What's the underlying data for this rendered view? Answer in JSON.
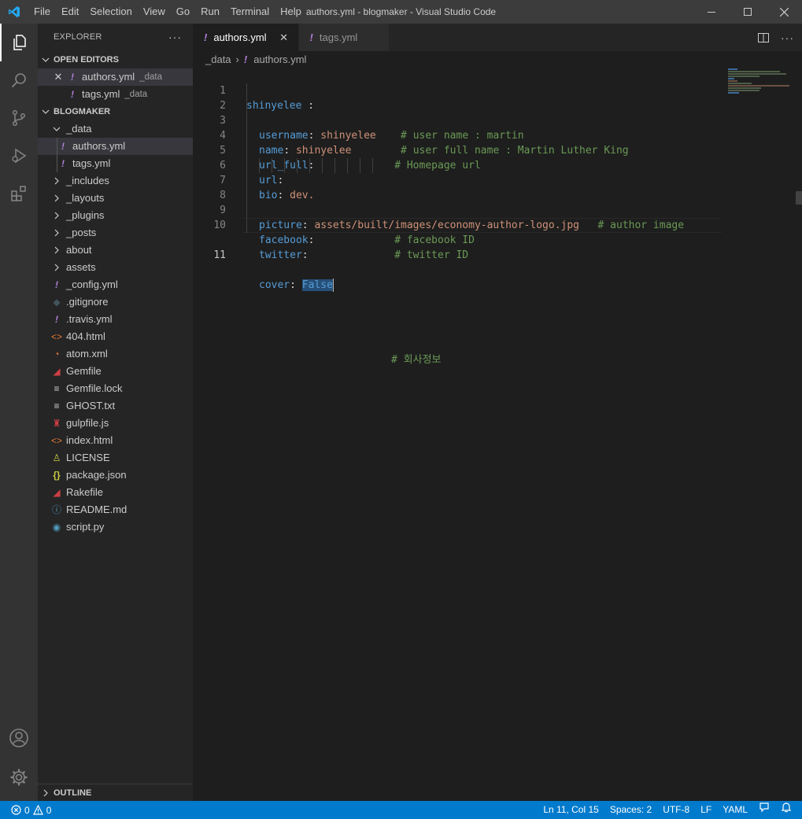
{
  "window": {
    "title": "authors.yml - blogmaker - Visual Studio Code"
  },
  "menu": [
    "File",
    "Edit",
    "Selection",
    "View",
    "Go",
    "Run",
    "Terminal",
    "Help"
  ],
  "sidebar": {
    "title": "EXPLORER",
    "open_editors": {
      "header": "OPEN EDITORS",
      "items": [
        {
          "name": "authors.yml",
          "desc": "_data"
        },
        {
          "name": "tags.yml",
          "desc": "_data"
        }
      ]
    },
    "project": {
      "header": "BLOGMAKER",
      "data_folder": "_data",
      "data_files": [
        "authors.yml",
        "tags.yml"
      ],
      "folders": [
        "_includes",
        "_layouts",
        "_plugins",
        "_posts",
        "about",
        "assets"
      ],
      "files": [
        "_config.yml",
        ".gitignore",
        ".travis.yml",
        "404.html",
        "atom.xml",
        "Gemfile",
        "Gemfile.lock",
        "GHOST.txt",
        "gulpfile.js",
        "index.html",
        "LICENSE",
        "package.json",
        "Rakefile",
        "README.md",
        "script.py"
      ]
    },
    "outline": "OUTLINE"
  },
  "tabs": [
    {
      "label": "authors.yml"
    },
    {
      "label": "tags.yml"
    }
  ],
  "breadcrumbs": [
    "_data",
    "authors.yml"
  ],
  "editor": {
    "lines": [
      {
        "n": "1",
        "key": "shinyelee",
        "sep": " :",
        "val": "",
        "cmt": ""
      },
      {
        "n": "2",
        "key": "username",
        "sep": ": ",
        "val": "shinyelee",
        "pad": "    ",
        "cmt": "# user name : martin"
      },
      {
        "n": "3",
        "key": "name",
        "sep": ": ",
        "val": "shinyelee",
        "pad": "        ",
        "cmt": "# user full name : Martin Luther King"
      },
      {
        "n": "4",
        "key": "url_full",
        "sep": ":",
        "val": "",
        "pad": "             ",
        "cmt": "# Homepage url"
      },
      {
        "n": "5",
        "key": "url",
        "sep": ":",
        "val": "",
        "cmt": ""
      },
      {
        "n": "6",
        "key": "bio",
        "sep": ": ",
        "val": "dev.",
        "cmt": ""
      },
      {
        "n": "7",
        "key": "",
        "sep": "",
        "val": "",
        "cmt": "# 회사정보"
      },
      {
        "n": "8",
        "key": "picture",
        "sep": ": ",
        "val": "assets/built/images/economy-author-logo.jpg",
        "pad": "   ",
        "cmt": "# author image"
      },
      {
        "n": "9",
        "key": "facebook",
        "sep": ":",
        "val": "",
        "pad": "             ",
        "cmt": "# facebook ID"
      },
      {
        "n": "10",
        "key": "twitter",
        "sep": ":",
        "val": "",
        "pad": "              ",
        "cmt": "# twitter ID"
      },
      {
        "n": "11",
        "key": "cover",
        "sep": ": ",
        "val": "False",
        "cmt": ""
      }
    ]
  },
  "status": {
    "errors": "0",
    "warnings": "0",
    "position": "Ln 11, Col 15",
    "spaces": "Spaces: 2",
    "encoding": "UTF-8",
    "eol": "LF",
    "language": "YAML"
  },
  "colors": {
    "accent": "#007acc",
    "yaml_icon": "#b180d7",
    "html_icon": "#e37933",
    "ruby_icon": "#cc3e44"
  }
}
